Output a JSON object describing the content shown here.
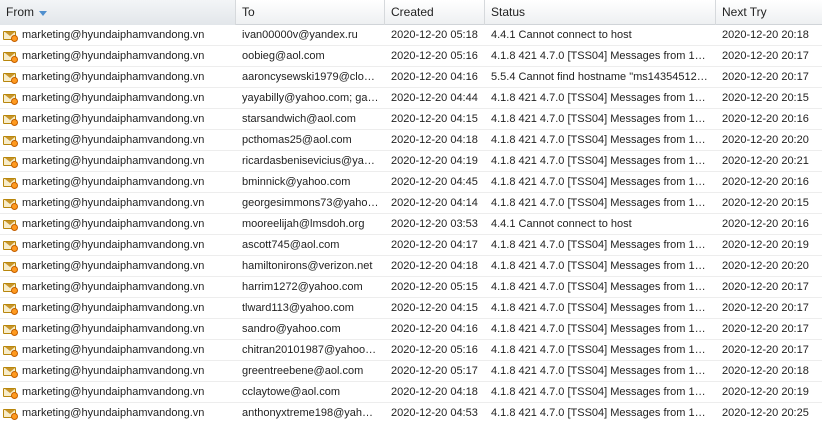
{
  "columns": {
    "from": "From",
    "to": "To",
    "created": "Created",
    "status": "Status",
    "next_try": "Next Try"
  },
  "colors": {
    "header_bg": "#eef0f2",
    "sort_arrow": "#4f8fce",
    "row_border": "#ededed",
    "icon_envelope": "#f7ecc9",
    "icon_clock": "#ff9a1f"
  },
  "icon": "queued-mail-icon",
  "rows": [
    {
      "from": "marketing@hyundaiphamvandong.vn",
      "to": "ivan00000v@yandex.ru",
      "created": "2020-12-20 05:18",
      "status": "4.4.1 Cannot connect to host",
      "next_try": "2020-12-20 20:18"
    },
    {
      "from": "marketing@hyundaiphamvandong.vn",
      "to": "oobieg@aol.com",
      "created": "2020-12-20 05:16",
      "status": "4.1.8 421 4.7.0 [TSS04] Messages from 1…",
      "next_try": "2020-12-20 20:17"
    },
    {
      "from": "marketing@hyundaiphamvandong.vn",
      "to": "aaroncysewski1979@clou…",
      "created": "2020-12-20 04:16",
      "status": "5.5.4 Cannot find hostname \"ms14354512…",
      "next_try": "2020-12-20 20:17"
    },
    {
      "from": "marketing@hyundaiphamvandong.vn",
      "to": "yayabilly@yahoo.com; ga…",
      "created": "2020-12-20 04:44",
      "status": "4.1.8 421 4.7.0 [TSS04] Messages from 1…",
      "next_try": "2020-12-20 20:15"
    },
    {
      "from": "marketing@hyundaiphamvandong.vn",
      "to": "starsandwich@aol.com",
      "created": "2020-12-20 04:15",
      "status": "4.1.8 421 4.7.0 [TSS04] Messages from 1…",
      "next_try": "2020-12-20 20:16"
    },
    {
      "from": "marketing@hyundaiphamvandong.vn",
      "to": "pcthomas25@aol.com",
      "created": "2020-12-20 04:18",
      "status": "4.1.8 421 4.7.0 [TSS04] Messages from 1…",
      "next_try": "2020-12-20 20:20"
    },
    {
      "from": "marketing@hyundaiphamvandong.vn",
      "to": "ricardasbenisevicius@yah…",
      "created": "2020-12-20 04:19",
      "status": "4.1.8 421 4.7.0 [TSS04] Messages from 1…",
      "next_try": "2020-12-20 20:21"
    },
    {
      "from": "marketing@hyundaiphamvandong.vn",
      "to": "bminnick@yahoo.com",
      "created": "2020-12-20 04:45",
      "status": "4.1.8 421 4.7.0 [TSS04] Messages from 1…",
      "next_try": "2020-12-20 20:16"
    },
    {
      "from": "marketing@hyundaiphamvandong.vn",
      "to": "georgesimmons73@yaho…",
      "created": "2020-12-20 04:14",
      "status": "4.1.8 421 4.7.0 [TSS04] Messages from 1…",
      "next_try": "2020-12-20 20:15"
    },
    {
      "from": "marketing@hyundaiphamvandong.vn",
      "to": "mooreelijah@lmsdoh.org",
      "created": "2020-12-20 03:53",
      "status": "4.4.1 Cannot connect to host",
      "next_try": "2020-12-20 20:16"
    },
    {
      "from": "marketing@hyundaiphamvandong.vn",
      "to": "ascott745@aol.com",
      "created": "2020-12-20 04:17",
      "status": "4.1.8 421 4.7.0 [TSS04] Messages from 1…",
      "next_try": "2020-12-20 20:19"
    },
    {
      "from": "marketing@hyundaiphamvandong.vn",
      "to": "hamiltonirons@verizon.net",
      "created": "2020-12-20 04:18",
      "status": "4.1.8 421 4.7.0 [TSS04] Messages from 1…",
      "next_try": "2020-12-20 20:20"
    },
    {
      "from": "marketing@hyundaiphamvandong.vn",
      "to": "harrim1272@yahoo.com",
      "created": "2020-12-20 05:15",
      "status": "4.1.8 421 4.7.0 [TSS04] Messages from 1…",
      "next_try": "2020-12-20 20:17"
    },
    {
      "from": "marketing@hyundaiphamvandong.vn",
      "to": "tlward113@yahoo.com",
      "created": "2020-12-20 04:15",
      "status": "4.1.8 421 4.7.0 [TSS04] Messages from 1…",
      "next_try": "2020-12-20 20:17"
    },
    {
      "from": "marketing@hyundaiphamvandong.vn",
      "to": "sandro@yahoo.com",
      "created": "2020-12-20 04:16",
      "status": "4.1.8 421 4.7.0 [TSS04] Messages from 1…",
      "next_try": "2020-12-20 20:17"
    },
    {
      "from": "marketing@hyundaiphamvandong.vn",
      "to": "chitran20101987@yahoo.…",
      "created": "2020-12-20 05:16",
      "status": "4.1.8 421 4.7.0 [TSS04] Messages from 1…",
      "next_try": "2020-12-20 20:17"
    },
    {
      "from": "marketing@hyundaiphamvandong.vn",
      "to": "greentreebene@aol.com",
      "created": "2020-12-20 05:17",
      "status": "4.1.8 421 4.7.0 [TSS04] Messages from 1…",
      "next_try": "2020-12-20 20:18"
    },
    {
      "from": "marketing@hyundaiphamvandong.vn",
      "to": "cclaytowe@aol.com",
      "created": "2020-12-20 04:18",
      "status": "4.1.8 421 4.7.0 [TSS04] Messages from 1…",
      "next_try": "2020-12-20 20:19"
    },
    {
      "from": "marketing@hyundaiphamvandong.vn",
      "to": "anthonyxtreme198@yaho…",
      "created": "2020-12-20 04:53",
      "status": "4.1.8 421 4.7.0 [TSS04] Messages from 1…",
      "next_try": "2020-12-20 20:25"
    }
  ]
}
